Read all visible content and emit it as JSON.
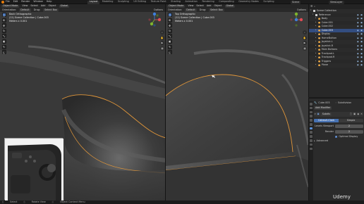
{
  "topbar": {
    "menus": [
      "File",
      "Edit",
      "Render",
      "Window",
      "Help"
    ],
    "tabs": [
      "Layout",
      "Modeling",
      "Sculpting",
      "UV Editing",
      "Texture Paint",
      "Shading",
      "Animation",
      "Rendering",
      "Compositing",
      "Geometry Nodes",
      "Scripting"
    ],
    "active_tab": "Layout",
    "scene_label": "Scene",
    "view_layer_label": "ViewLayer"
  },
  "viewport_left": {
    "mode": "Object Mode",
    "menus": [
      "View",
      "Select",
      "Add",
      "Object"
    ],
    "orientation_label": "Orientation:",
    "orientation": "Default",
    "drag_label": "Drag:",
    "drag": "Select Box",
    "transform": "Global",
    "options": "Options",
    "info": [
      "Back Orthographic",
      "(11) Scene Collection | Cube.003",
      "Meters x 0.001"
    ]
  },
  "viewport_right": {
    "mode": "Object Mode",
    "menus": [
      "View",
      "Select",
      "Add",
      "Object"
    ],
    "orientation_label": "Orientation:",
    "orientation": "Default",
    "drag_label": "Drag:",
    "drag": "Select Box",
    "transform": "Global",
    "options": "Options",
    "info": [
      "Top Orthographic",
      "(11) Scene Collection | Cube.003",
      "Meters x 0.001"
    ]
  },
  "gizmo": {
    "x": "X",
    "y": "Y",
    "z": "Z"
  },
  "outliner": {
    "title": "Scene Collection",
    "items": [
      {
        "label": "Scene Collection",
        "type": "collection",
        "selected": false
      },
      {
        "label": "Reference",
        "type": "collection",
        "selected": false
      },
      {
        "label": "Body",
        "type": "mesh",
        "selected": false
      },
      {
        "label": "Cube.001",
        "type": "mesh",
        "selected": false
      },
      {
        "label": "Cube.002",
        "type": "mesh",
        "selected": false
      },
      {
        "label": "Cube.003",
        "type": "mesh",
        "selected": true
      },
      {
        "label": "Display",
        "type": "mesh",
        "selected": false
      },
      {
        "label": "HomeButton",
        "type": "mesh",
        "selected": false
      },
      {
        "label": "Joystick.L",
        "type": "mesh",
        "selected": false
      },
      {
        "label": "Joystick.R",
        "type": "mesh",
        "selected": false
      },
      {
        "label": "Main Buttons",
        "type": "mesh",
        "selected": false
      },
      {
        "label": "Trackpad.L",
        "type": "mesh",
        "selected": false
      },
      {
        "label": "Trackpad.R",
        "type": "mesh",
        "selected": false
      },
      {
        "label": "Triggers",
        "type": "mesh",
        "selected": false
      },
      {
        "label": "Plane",
        "type": "mesh",
        "selected": false
      }
    ]
  },
  "properties": {
    "object_name": "Cube.003",
    "modifier_label": "Subdivision",
    "add_modifier": "Add Modifier",
    "modifier_name": "Subdiv",
    "tabs": [
      "Catmull-Clark",
      "Simple"
    ],
    "active_tab": "Catmull-Clark",
    "levels_viewport_label": "Levels Viewport",
    "levels_viewport": "2",
    "render_label": "Render",
    "render": "2",
    "optimal_display_label": "Optimal Display",
    "advanced_label": "Advanced"
  },
  "statusbar": {
    "items": [
      "Select",
      "Rotate View",
      "Object Context Menu"
    ]
  },
  "watermark": "Udemy",
  "colors": {
    "accent": "#e87d0d",
    "selection": "#334d80",
    "active_button": "#4772b3",
    "axis_x": "#e24b55",
    "axis_y": "#7fb52d",
    "axis_z": "#3f7fdc"
  }
}
